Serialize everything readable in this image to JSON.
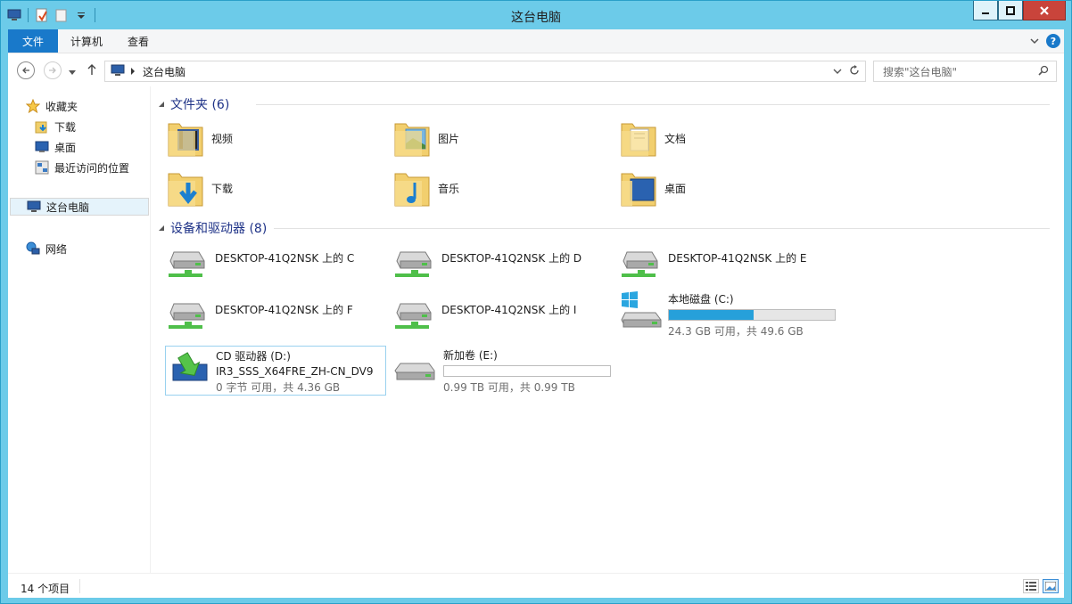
{
  "window": {
    "title": "这台电脑"
  },
  "ribbon": {
    "tabs": [
      "文件",
      "计算机",
      "查看"
    ]
  },
  "address": {
    "path": "这台电脑",
    "search_placeholder": "搜索\"这台电脑\""
  },
  "nav": {
    "favorites": "收藏夹",
    "downloads": "下载",
    "desktop": "桌面",
    "recent": "最近访问的位置",
    "this_pc": "这台电脑",
    "network": "网络"
  },
  "folders": {
    "header": "文件夹 (6)",
    "items": [
      "视频",
      "图片",
      "文档",
      "下载",
      "音乐",
      "桌面"
    ]
  },
  "devices": {
    "header": "设备和驱动器 (8)",
    "network_drives": [
      "DESKTOP-41Q2NSK 上的 C",
      "DESKTOP-41Q2NSK 上的 D",
      "DESKTOP-41Q2NSK 上的 E",
      "DESKTOP-41Q2NSK 上的 F",
      "DESKTOP-41Q2NSK 上的 I"
    ],
    "local_c": {
      "name": "本地磁盘 (C:)",
      "space": "24.3 GB 可用，共 49.6 GB",
      "used_fraction": 0.51
    },
    "cd": {
      "name": "CD 驱动器 (D:)",
      "label": "IR3_SSS_X64FRE_ZH-CN_DV9",
      "space": "0 字节 可用，共 4.36 GB"
    },
    "new_vol": {
      "name": "新加卷 (E:)",
      "space": "0.99 TB 可用，共 0.99 TB",
      "used_fraction": 0.0
    }
  },
  "status": {
    "count": "14 个项目"
  },
  "colors": {
    "accent": "#1979ca",
    "titlebar": "#6ccbe9",
    "bar_fill": "#26a0da",
    "close": "#c9443b"
  }
}
